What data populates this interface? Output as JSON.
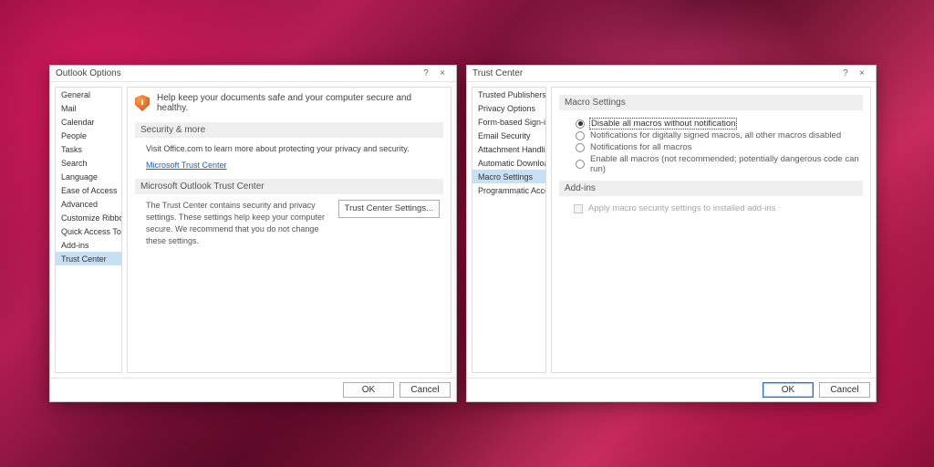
{
  "dialog1": {
    "title": "Outlook Options",
    "sidebar": [
      "General",
      "Mail",
      "Calendar",
      "People",
      "Tasks",
      "Search",
      "Language",
      "Ease of Access",
      "Advanced",
      "Customize Ribbon",
      "Quick Access Toolbar",
      "Add-ins",
      "Trust Center"
    ],
    "selected_index": 12,
    "intro": "Help keep your documents safe and your computer secure and healthy.",
    "section1_title": "Security & more",
    "section1_text": "Visit Office.com to learn more about protecting your privacy and security.",
    "section1_link": "Microsoft Trust Center",
    "section2_title": "Microsoft Outlook Trust Center",
    "section2_text": "The Trust Center contains security and privacy settings. These settings help keep your computer secure. We recommend that you do not change these settings.",
    "section2_button": "Trust Center Settings...",
    "ok": "OK",
    "cancel": "Cancel"
  },
  "dialog2": {
    "title": "Trust Center",
    "sidebar": [
      "Trusted Publishers",
      "Privacy Options",
      "Form-based Sign-in",
      "Email Security",
      "Attachment Handling",
      "Automatic Download",
      "Macro Settings",
      "Programmatic Access"
    ],
    "selected_index": 6,
    "group1_title": "Macro Settings",
    "radios": [
      "Disable all macros without notification",
      "Notifications for digitally signed macros, all other macros disabled",
      "Notifications for all macros",
      "Enable all macros (not recommended; potentially dangerous code can run)"
    ],
    "radio_selected": 0,
    "group2_title": "Add-ins",
    "addins_checkbox": "Apply macro security settings to installed add-ins",
    "ok": "OK",
    "cancel": "Cancel"
  }
}
